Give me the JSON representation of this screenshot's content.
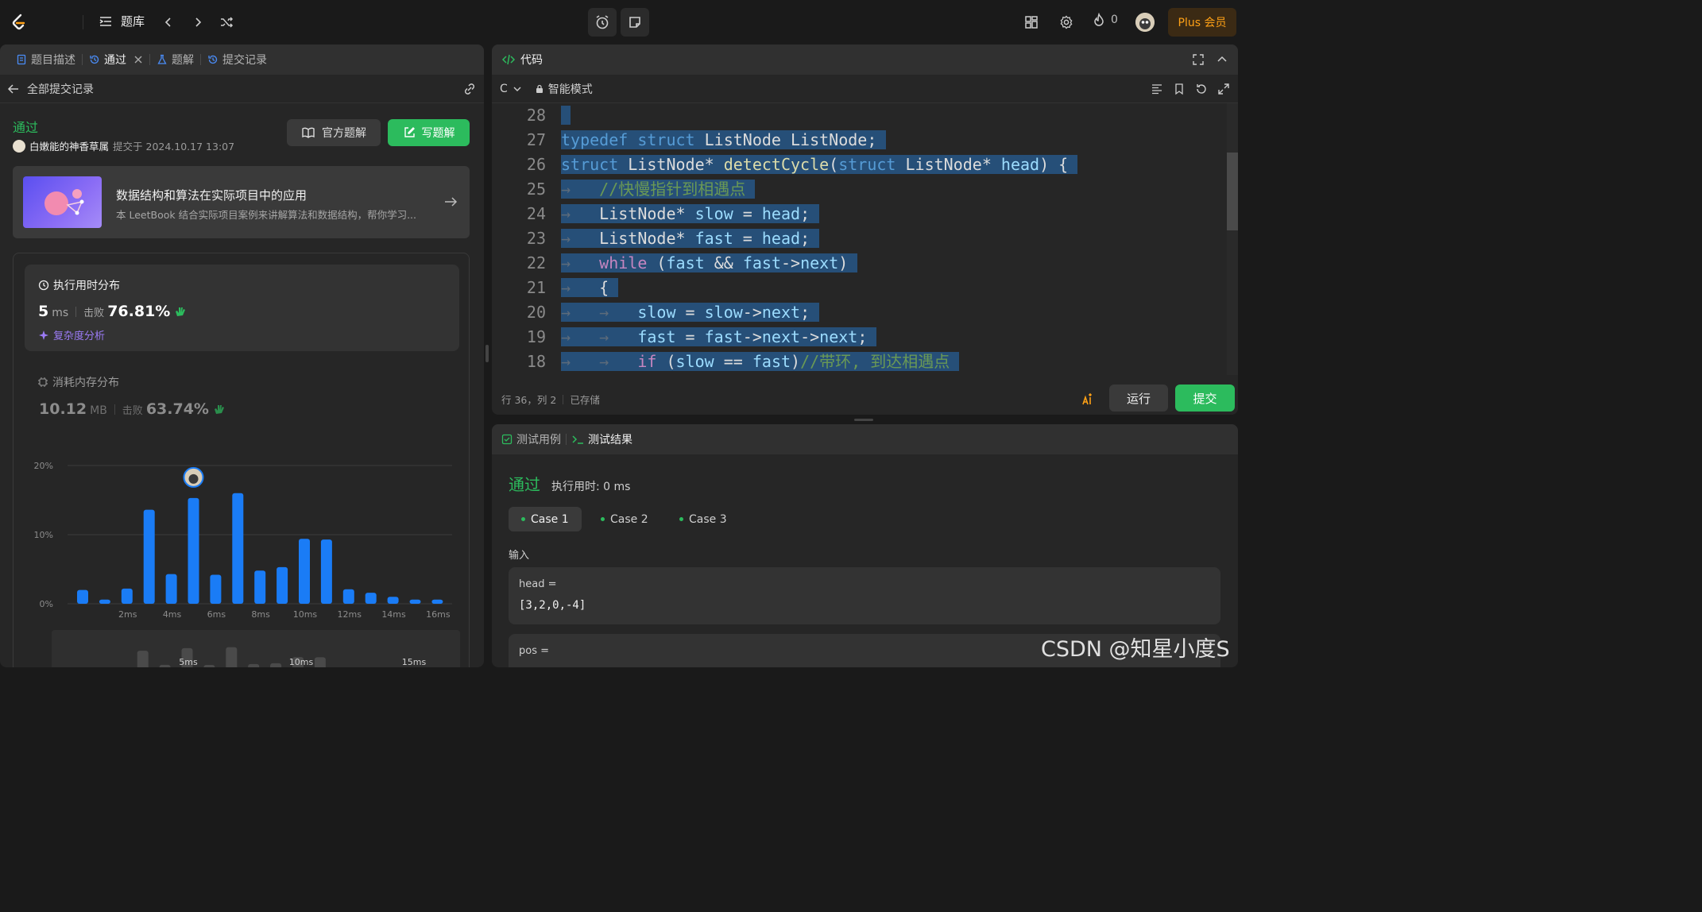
{
  "topbar": {
    "problems_label": "题库",
    "streak_count": "0",
    "plus_label": "Plus 会员"
  },
  "left": {
    "tabs": [
      {
        "label": "题目描述"
      },
      {
        "label": "通过"
      },
      {
        "label": "题解"
      },
      {
        "label": "提交记录"
      }
    ],
    "back_label": "全部提交记录",
    "status": "通过",
    "user": "白嫩能的神香草属",
    "submitted_at": "提交于 2024.10.17 13:07",
    "official_btn": "官方题解",
    "write_btn": "写题解",
    "book": {
      "title": "数据结构和算法在实际项目中的应用",
      "desc": "本 LeetBook 结合实际项目案例来讲解算法和数据结构，帮你学习..."
    },
    "runtime": {
      "title": "执行用时分布",
      "value": "5",
      "unit": "ms",
      "beat_label": "击败",
      "beat_pct": "76.81%",
      "complexity_link": "复杂度分析"
    },
    "memory": {
      "title": "消耗内存分布",
      "value": "10.12",
      "unit": "MB",
      "beat_label": "击败",
      "beat_pct": "63.74%"
    }
  },
  "chart_data": {
    "type": "bar",
    "ylim": [
      0,
      20
    ],
    "yticks": [
      "20%",
      "10%",
      "0%"
    ],
    "xticks": [
      "2ms",
      "4ms",
      "6ms",
      "8ms",
      "10ms",
      "12ms",
      "14ms",
      "16ms"
    ],
    "values": [
      2,
      0.6,
      2.2,
      13.6,
      4.3,
      15.3,
      4.2,
      16,
      4.8,
      5.3,
      9.4,
      9.3,
      2.1,
      1.6,
      1.0,
      0.6,
      0.6
    ],
    "highlight_index": 5,
    "mini_labels": [
      "5ms",
      "10ms",
      "15ms"
    ],
    "colors": {
      "bar": "#1a7cf6",
      "mini": "#4a4a4a"
    }
  },
  "code": {
    "tab_label": "代码",
    "language": "C",
    "mode": "智能模式",
    "lines": [
      {
        "n": "28",
        "t": ""
      },
      {
        "n": "27",
        "t": "typedef struct ListNode ListNode;"
      },
      {
        "n": "26",
        "t": "struct ListNode* detectCycle(struct ListNode* head) {"
      },
      {
        "n": "25",
        "t": "  //快慢指针到相遇点"
      },
      {
        "n": "24",
        "t": "ListNode* slow = head;"
      },
      {
        "n": "23",
        "t": "ListNode* fast = head;"
      },
      {
        "n": "22",
        "t": "while (fast && fast->next)"
      },
      {
        "n": "21",
        "t": "{"
      },
      {
        "n": "20",
        "t": "slow = slow->next;"
      },
      {
        "n": "19",
        "t": "fast = fast->next->next;"
      },
      {
        "n": "18",
        "t": "if (slow == fast)//带环, 到达相遇点"
      }
    ],
    "status_pos": "行 36，列 2",
    "status_saved": "已存储",
    "run_btn": "运行",
    "submit_btn": "提交"
  },
  "tests": {
    "tab_cases": "测试用例",
    "tab_result": "测试结果",
    "result": "通过",
    "runtime": "执行用时: 0 ms",
    "cases": [
      "Case 1",
      "Case 2",
      "Case 3"
    ],
    "input_label": "输入",
    "inputs": [
      {
        "name": "head =",
        "value": "[3,2,0,-4]"
      },
      {
        "name": "pos =",
        "value": ""
      }
    ]
  },
  "watermark": "CSDN @知星小度S"
}
